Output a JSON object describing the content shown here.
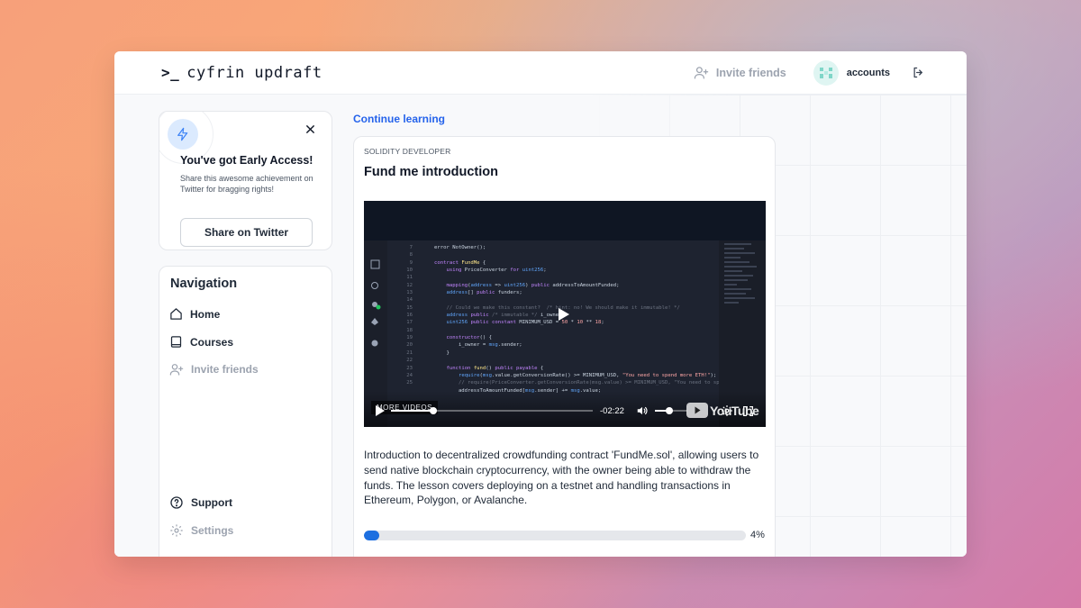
{
  "app": {
    "logo_text": "cyfrin updraft"
  },
  "topbar": {
    "invite_label": "Invite friends",
    "account_label": "accounts"
  },
  "early_access": {
    "title": "You've got Early Access!",
    "text": "Share this awesome achievement on Twitter for bragging rights!",
    "share_button": "Share on Twitter"
  },
  "navigation": {
    "title": "Navigation",
    "items": [
      {
        "label": "Home",
        "icon": "home-icon"
      },
      {
        "label": "Courses",
        "icon": "book-icon"
      },
      {
        "label": "Invite friends",
        "icon": "user-plus-icon"
      }
    ],
    "bottom_items": [
      {
        "label": "Support",
        "icon": "help-circle-icon"
      },
      {
        "label": "Settings",
        "icon": "gear-icon"
      }
    ]
  },
  "main": {
    "continue_label": "Continue learning",
    "lesson": {
      "eyebrow": "SOLIDITY DEVELOPER",
      "title": "Fund me introduction",
      "description": "Introduction to decentralized crowdfunding contract 'FundMe.sol', allowing users to send native blockchain cryptocurrency, with the owner being able to withdraw the funds. The lesson covers deploying on a testnet and handling transactions in Ethereum, Polygon, or Avalanche.",
      "progress_percent": 4,
      "progress_label": "4%"
    },
    "video": {
      "time_remaining": "-02:22",
      "more_videos": "MORE VIDEOS",
      "watch_progress": 0.21,
      "volume_level": 0.45,
      "brand": "YouTube"
    }
  },
  "colors": {
    "accent": "#2563eb",
    "progress": "#1d6fe0",
    "bolt_bg": "#dbeafe"
  }
}
